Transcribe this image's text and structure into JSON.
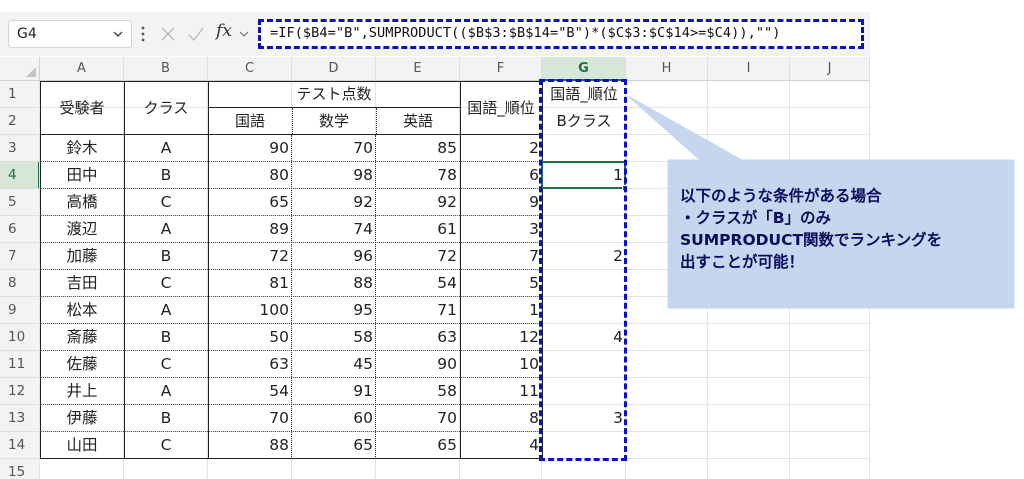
{
  "name_box": {
    "value": "G4"
  },
  "formula_bar": {
    "fx_label": "fx",
    "formula": "=IF($B4=\"B\",SUMPRODUCT(($B$3:$B$14=\"B\")*($C$3:$C$14>=$C4)),\"\")"
  },
  "column_headers": [
    "A",
    "B",
    "C",
    "D",
    "E",
    "F",
    "G",
    "H",
    "I",
    "J"
  ],
  "selected_column": "G",
  "row_headers": [
    "1",
    "2",
    "3",
    "4",
    "5",
    "6",
    "7",
    "8",
    "9",
    "10",
    "11",
    "12",
    "13",
    "14",
    "15"
  ],
  "selected_row": "4",
  "table": {
    "header_examinee": "受験者",
    "header_class": "クラス",
    "header_test_scores": "テスト点数",
    "header_japanese": "国語",
    "header_math": "数学",
    "header_english": "英語",
    "header_rank": "国語_順位",
    "header_rank_b_line1": "国語_順位",
    "header_rank_b_line2": "Bクラス",
    "rows": [
      {
        "name": "鈴木",
        "cls": "A",
        "japanese": "90",
        "math": "70",
        "english": "85",
        "rank": "2",
        "rank_b": ""
      },
      {
        "name": "田中",
        "cls": "B",
        "japanese": "80",
        "math": "98",
        "english": "78",
        "rank": "6",
        "rank_b": "1"
      },
      {
        "name": "高橋",
        "cls": "C",
        "japanese": "65",
        "math": "92",
        "english": "92",
        "rank": "9",
        "rank_b": ""
      },
      {
        "name": "渡辺",
        "cls": "A",
        "japanese": "89",
        "math": "74",
        "english": "61",
        "rank": "3",
        "rank_b": ""
      },
      {
        "name": "加藤",
        "cls": "B",
        "japanese": "72",
        "math": "96",
        "english": "72",
        "rank": "7",
        "rank_b": "2"
      },
      {
        "name": "吉田",
        "cls": "C",
        "japanese": "81",
        "math": "88",
        "english": "54",
        "rank": "5",
        "rank_b": ""
      },
      {
        "name": "松本",
        "cls": "A",
        "japanese": "100",
        "math": "95",
        "english": "71",
        "rank": "1",
        "rank_b": ""
      },
      {
        "name": "斎藤",
        "cls": "B",
        "japanese": "50",
        "math": "58",
        "english": "63",
        "rank": "12",
        "rank_b": "4"
      },
      {
        "name": "佐藤",
        "cls": "C",
        "japanese": "63",
        "math": "45",
        "english": "90",
        "rank": "10",
        "rank_b": ""
      },
      {
        "name": "井上",
        "cls": "A",
        "japanese": "54",
        "math": "91",
        "english": "58",
        "rank": "11",
        "rank_b": ""
      },
      {
        "name": "伊藤",
        "cls": "B",
        "japanese": "70",
        "math": "60",
        "english": "70",
        "rank": "8",
        "rank_b": "3"
      },
      {
        "name": "山田",
        "cls": "C",
        "japanese": "88",
        "math": "65",
        "english": "65",
        "rank": "4",
        "rank_b": ""
      }
    ]
  },
  "callout": {
    "lines": [
      "以下のような条件がある場合",
      "・クラスが「B」のみ",
      "SUMPRODUCT関数でランキングを",
      "出すことが可能！"
    ]
  },
  "colors": {
    "highlight_dashed": "#0a10c8",
    "callout_fill": "#c5d6ee",
    "callout_text": "#0b0b5e",
    "selection": "#1f7145",
    "header_bg": "#f3f3f3"
  }
}
